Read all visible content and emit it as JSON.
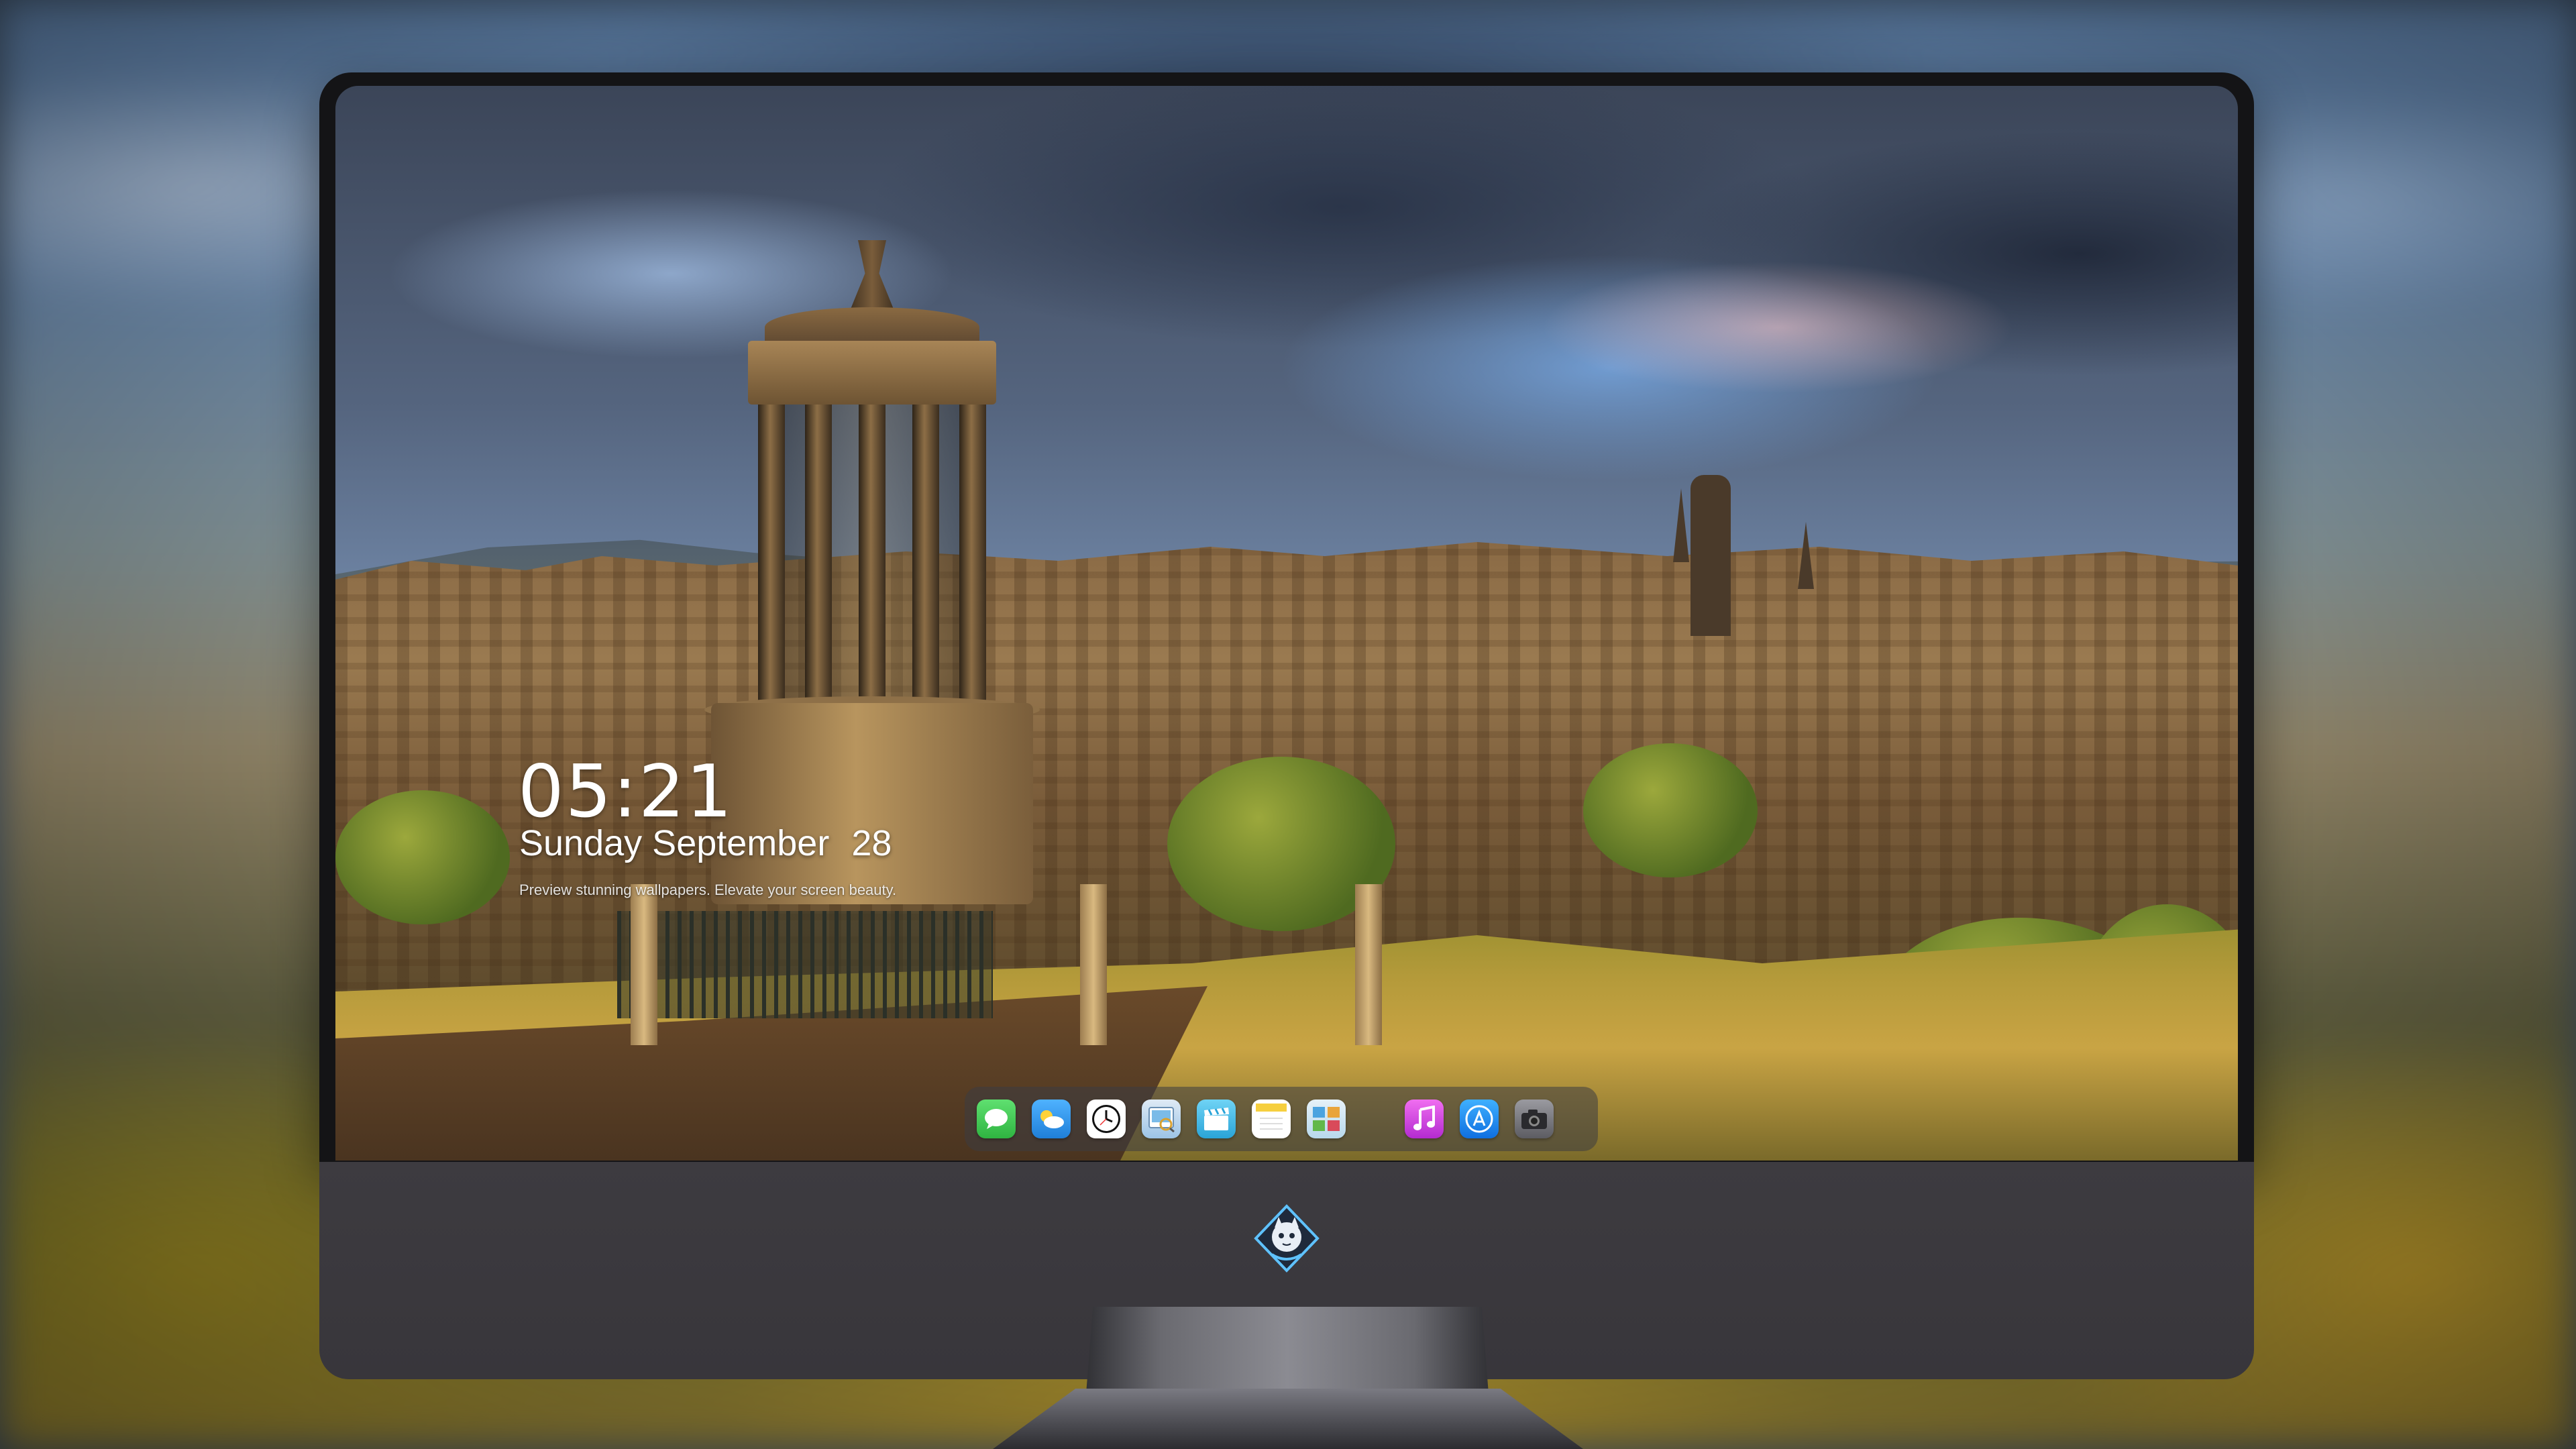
{
  "lockscreen": {
    "time": "05:21",
    "weekday": "Sunday",
    "month": "September",
    "day": "28",
    "tagline": "Preview stunning wallpapers. Elevate your screen beauty."
  },
  "dock": {
    "items": [
      {
        "name": "messages",
        "icon": "message-icon",
        "color": "#3ccf4e"
      },
      {
        "name": "weather",
        "icon": "weather-icon",
        "color": "#3aa0f0"
      },
      {
        "name": "clock",
        "icon": "clock-icon",
        "color": "#ffffff"
      },
      {
        "name": "preview",
        "icon": "preview-icon",
        "color": "#6fb5e8"
      },
      {
        "name": "clips",
        "icon": "clapperboard-icon",
        "color": "#4ab6e0"
      },
      {
        "name": "notes",
        "icon": "notes-icon",
        "color": "#f5d24a"
      },
      {
        "name": "photos",
        "icon": "photos-icon",
        "color": "#8ecbe8"
      },
      {
        "name": "music",
        "icon": "music-icon",
        "color": "#e14ad0"
      },
      {
        "name": "app-store",
        "icon": "app-store-icon",
        "color": "#1e8ef2"
      },
      {
        "name": "camera",
        "icon": "camera-icon",
        "color": "#7a7a80"
      }
    ]
  },
  "brand": {
    "logo": "mascot-logo-icon",
    "accent": "#5fc2ff"
  }
}
